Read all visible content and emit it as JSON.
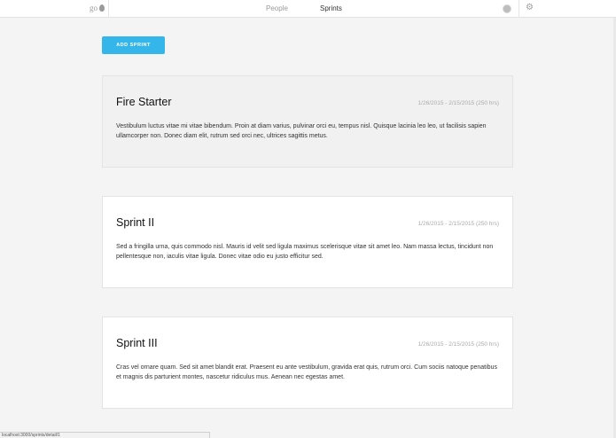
{
  "nav": {
    "logo_text": "go",
    "links": [
      "People",
      "Sprints"
    ]
  },
  "actions": {
    "add_sprint_label": "ADD SPRINT"
  },
  "sprints": [
    {
      "title": "Fire Starter",
      "dates": "1/26/2015 - 2/15/2015 (250 hrs)",
      "description": "Vestibulum luctus vitae mi vitae bibendum. Proin at diam varius, pulvinar orci eu, tempus nisl. Quisque lacinia leo leo, ut facilisis sapien ullamcorper non. Donec diam elit, rutrum sed orci nec, ultrices sagittis metus."
    },
    {
      "title": "Sprint II",
      "dates": "1/26/2015 - 2/15/2015 (250 hrs)",
      "description": "Sed a fringilla urna, quis commodo nisl. Mauris id velit sed ligula maximus scelerisque vitae sit amet leo. Nam massa lectus, tincidunt non pellentesque non, iaculis vitae ligula. Donec vitae odio eu justo efficitur sed."
    },
    {
      "title": "Sprint III",
      "dates": "1/26/2015 - 2/15/2015 (250 hrs)",
      "description": "Cras vel ornare quam. Sed sit amet blandit erat. Praesent eu ante vestibulum, gravida erat quis, rutrum orci. Cum sociis natoque penatibus et magnis dis parturient montes, nascetur ridiculus mus. Aenean nec egestas amet."
    }
  ],
  "status_bar": {
    "url": "localhost:3000/sprints/detail/1"
  },
  "colors": {
    "accent": "#35b6ea",
    "highlight_card": "#f1f1f1"
  }
}
